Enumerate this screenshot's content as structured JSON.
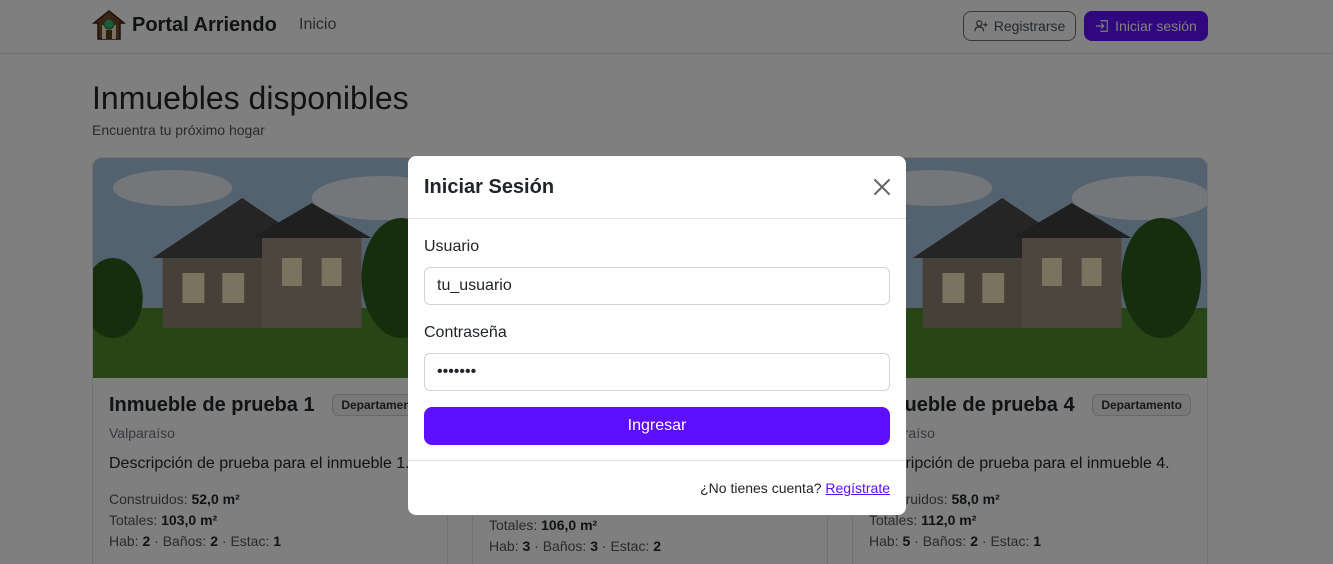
{
  "navbar": {
    "brand": "Portal Arriendo",
    "home_link": "Inicio",
    "register_label": "Registrarse",
    "login_label": "Iniciar sesión"
  },
  "page": {
    "title": "Inmuebles disponibles",
    "subtitle": "Encuentra tu próximo hogar"
  },
  "cards": [
    {
      "title": "Inmueble de prueba 1",
      "badge": "Departamento",
      "city": "Valparaíso",
      "description": "Descripción de prueba para el inmueble 1.",
      "built_label": "Construidos:",
      "built": "52,0 m²",
      "total_label": "Totales:",
      "total": "103,0 m²",
      "rooms_label": "Hab:",
      "rooms": "2",
      "baths_label": "Baños:",
      "baths": "2",
      "parking_label": "Estac:",
      "parking": "1"
    },
    {
      "title": "",
      "badge": "",
      "city": "",
      "description": "",
      "built_label": "",
      "built": "",
      "total_label": "Totales:",
      "total": "106,0 m²",
      "rooms_label": "Hab:",
      "rooms": "3",
      "baths_label": "Baños:",
      "baths": "3",
      "parking_label": "Estac:",
      "parking": "2"
    },
    {
      "title": "Inmueble de prueba 4",
      "badge": "Departamento",
      "city": "Valparaíso",
      "description": "Descripción de prueba para el inmueble 4.",
      "built_label": "Construidos:",
      "built": "58,0 m²",
      "total_label": "Totales:",
      "total": "112,0 m²",
      "rooms_label": "Hab:",
      "rooms": "5",
      "baths_label": "Baños:",
      "baths": "2",
      "parking_label": "Estac:",
      "parking": "1"
    }
  ],
  "modal": {
    "title": "Iniciar Sesión",
    "username_label": "Usuario",
    "username_value": "tu_usuario",
    "password_label": "Contraseña",
    "password_value": "•••••••",
    "submit_label": "Ingresar",
    "footer_prompt": "¿No tienes cuenta?",
    "footer_link": "Regístrate"
  },
  "colors": {
    "accent": "#5e0fff",
    "backdrop": "rgba(0,0,0,0.5)"
  }
}
